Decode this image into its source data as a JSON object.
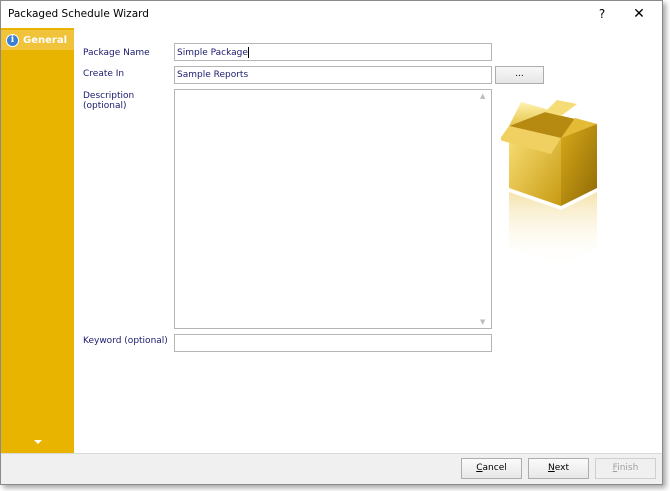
{
  "window": {
    "title": "Packaged Schedule Wizard",
    "help_label": "?",
    "close_label": "✕"
  },
  "sidebar": {
    "items": [
      {
        "label": "General",
        "icon": "info-icon",
        "selected": true
      }
    ]
  },
  "form": {
    "package_name": {
      "label": "Package Name",
      "value": "Simple Package"
    },
    "create_in": {
      "label": "Create In",
      "value": "Sample Reports",
      "browse_label": "..."
    },
    "description": {
      "label_line1": "Description",
      "label_line2": "(optional)",
      "value": ""
    },
    "keyword": {
      "label": "Keyword (optional)",
      "value": ""
    }
  },
  "footer": {
    "cancel_accel": "C",
    "cancel_rest": "ancel",
    "next_accel": "N",
    "next_rest": "ext",
    "finish_accel": "F",
    "finish_rest": "inish"
  },
  "colors": {
    "sidebar": "#e9b400",
    "sidebar_selected": "#f0c33a",
    "label_text": "#1a1a6e"
  }
}
